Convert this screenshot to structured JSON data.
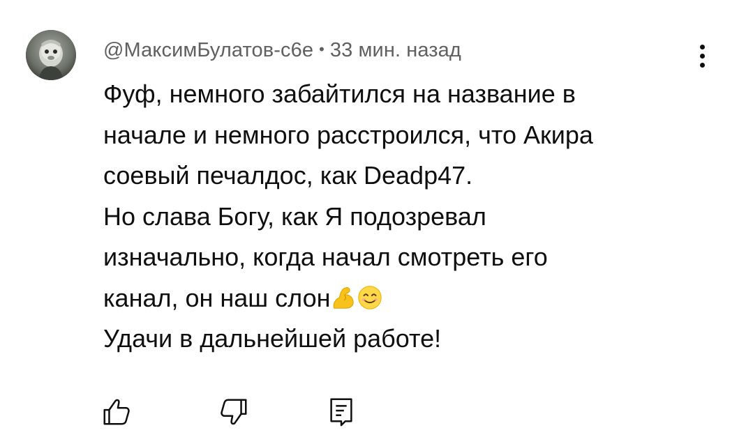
{
  "comment": {
    "author": "@МаксимБулатов-с6е",
    "separator": "•",
    "time": "33 мин. назад",
    "lines": {
      "l1": "Фуф, немного забайтился на название в",
      "l2": "начале и немного расстроился, что Акира",
      "l3": "соевый печалдос, как Deadp47.",
      "l4": "Но слава Богу, как Я подозревал",
      "l5": "изначально, когда начал смотреть его",
      "l6": "канал, он наш слон",
      "l7": "Удачи в дальнейшей работе!"
    },
    "emojis": [
      "flexed-biceps",
      "smiling-face"
    ]
  },
  "icons": {
    "avatar": "avatar-image",
    "more": "more-vertical-icon",
    "like": "thumbs-up-icon",
    "dislike": "thumbs-down-icon",
    "reply": "reply-comment-icon"
  },
  "colors": {
    "text": "#0f0f0f",
    "meta": "#606060",
    "background": "#ffffff"
  }
}
